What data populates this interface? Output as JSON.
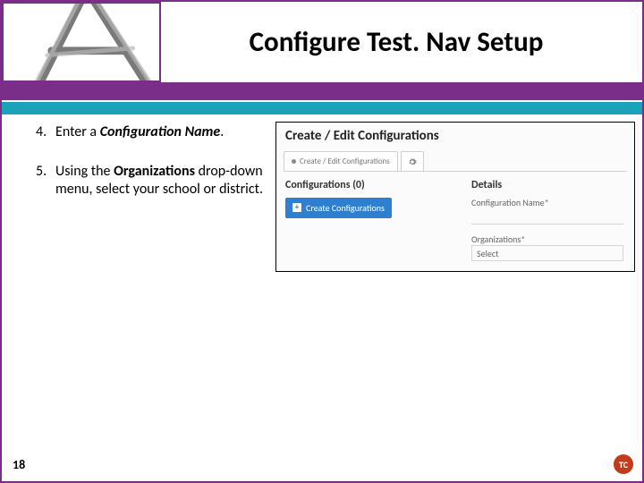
{
  "title": "Configure Test. Nav Setup",
  "steps": [
    {
      "num": "4.",
      "lead": "Enter a ",
      "bold_italic": "Configuration Name",
      "tail": "."
    },
    {
      "num": "5.",
      "lead": "Using the ",
      "bold": "Organizations",
      "tail": " drop-down menu, select your school or district."
    }
  ],
  "screenshot": {
    "heading": "Create / Edit Configurations",
    "tab_label": "Create / Edit Configurations",
    "left_heading": "Configurations (0)",
    "create_button": "Create Configurations",
    "right_heading": "Details",
    "field_config_name": "Configuration Name*",
    "field_orgs": "Organizations*",
    "select_placeholder": "Select"
  },
  "page_number": "18",
  "badge": "TC"
}
